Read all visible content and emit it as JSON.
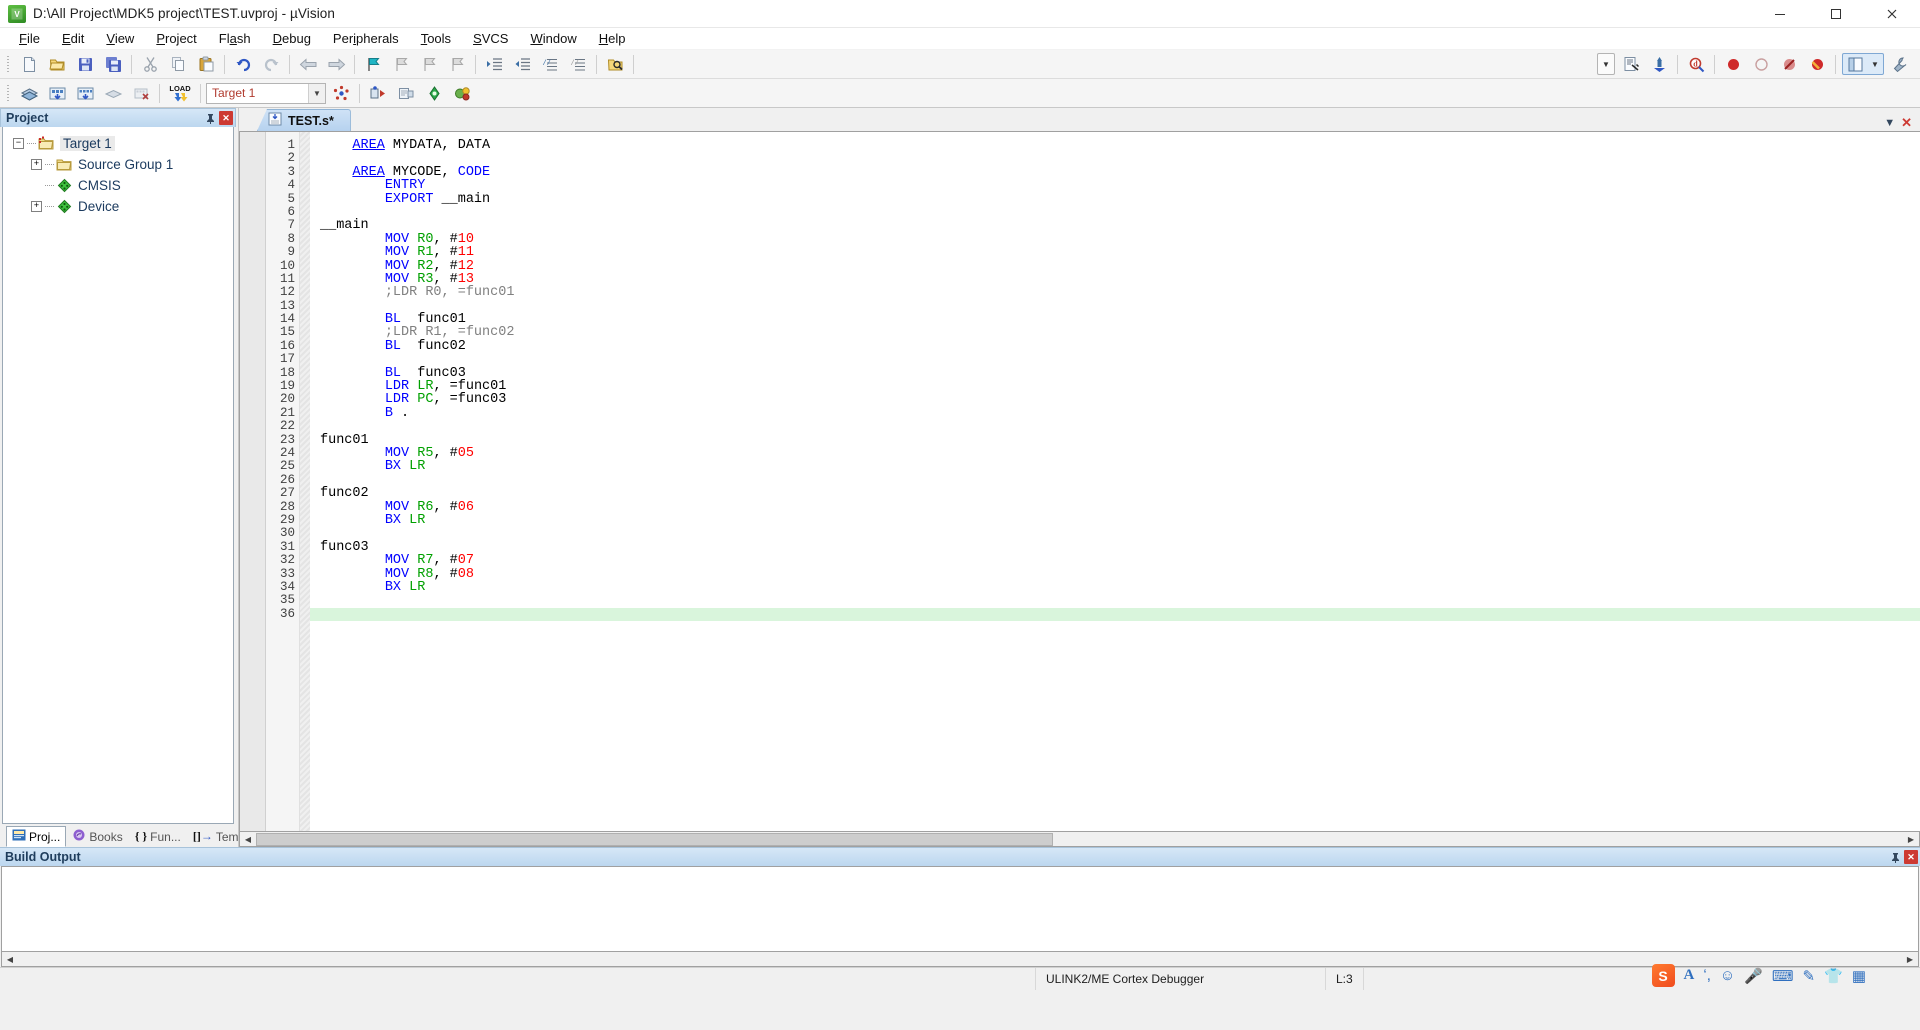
{
  "window": {
    "title": "D:\\All Project\\MDK5 project\\TEST.uvproj - µVision",
    "app_icon": "uvision-logo-icon",
    "minimize": "─",
    "maximize": "□",
    "close": "✕"
  },
  "menu": {
    "items": [
      {
        "label": "File",
        "accel": "F"
      },
      {
        "label": "Edit",
        "accel": "E"
      },
      {
        "label": "View",
        "accel": "V"
      },
      {
        "label": "Project",
        "accel": "P"
      },
      {
        "label": "Flash",
        "accel": "a"
      },
      {
        "label": "Debug",
        "accel": "D"
      },
      {
        "label": "Peripherals",
        "accel": "i"
      },
      {
        "label": "Tools",
        "accel": "T"
      },
      {
        "label": "SVCS",
        "accel": "S"
      },
      {
        "label": "Window",
        "accel": "W"
      },
      {
        "label": "Help",
        "accel": "H"
      }
    ]
  },
  "toolbar_main": {
    "buttons": [
      {
        "name": "new-file-icon",
        "title": "New"
      },
      {
        "name": "open-file-icon",
        "title": "Open"
      },
      {
        "name": "save-icon",
        "title": "Save"
      },
      {
        "name": "save-all-icon",
        "title": "Save All"
      },
      {
        "name": "cut-icon",
        "title": "Cut"
      },
      {
        "name": "copy-icon",
        "title": "Copy"
      },
      {
        "name": "paste-icon",
        "title": "Paste"
      },
      {
        "name": "undo-icon",
        "title": "Undo"
      },
      {
        "name": "redo-icon",
        "title": "Redo"
      },
      {
        "name": "back-icon",
        "title": "Navigate Backwards"
      },
      {
        "name": "forward-icon",
        "title": "Navigate Forwards"
      },
      {
        "name": "bookmark-toggle-icon",
        "title": "Insert/Remove Bookmark"
      },
      {
        "name": "bookmark-prev-icon",
        "title": "Previous Bookmark"
      },
      {
        "name": "bookmark-next-icon",
        "title": "Next Bookmark"
      },
      {
        "name": "bookmark-clear-icon",
        "title": "Clear All Bookmarks"
      },
      {
        "name": "indent-icon",
        "title": "Indent"
      },
      {
        "name": "outdent-icon",
        "title": "Outdent"
      },
      {
        "name": "comment-icon",
        "title": "Comment"
      },
      {
        "name": "uncomment-icon",
        "title": "Uncomment"
      },
      {
        "name": "find-in-files-icon",
        "title": "Find in Files"
      },
      {
        "name": "configure-icon",
        "title": "Configuration Wizard"
      },
      {
        "name": "bookmark-flag-icon",
        "title": "Bookmarks"
      },
      {
        "name": "find-icon",
        "title": "Find"
      },
      {
        "name": "breakpoint-icon",
        "title": "Insert/Remove Breakpoint"
      },
      {
        "name": "breakpoint-disable-icon",
        "title": "Enable/Disable Breakpoint"
      },
      {
        "name": "breakpoint-disable-all-icon",
        "title": "Disable All Breakpoints"
      },
      {
        "name": "breakpoint-kill-all-icon",
        "title": "Kill All Breakpoints"
      },
      {
        "name": "window-layout-icon",
        "title": "Manage Window Layout"
      },
      {
        "name": "wrench-icon",
        "title": "Configure"
      }
    ]
  },
  "toolbar_build": {
    "buttons": [
      {
        "name": "translate-icon",
        "title": "Translate"
      },
      {
        "name": "build-icon",
        "title": "Build"
      },
      {
        "name": "rebuild-icon",
        "title": "Rebuild"
      },
      {
        "name": "batch-build-icon",
        "title": "Batch Build"
      },
      {
        "name": "stop-build-icon",
        "title": "Stop Build"
      },
      {
        "name": "download-icon",
        "title": "Download"
      },
      {
        "name": "target-options-icon",
        "title": "Target Options"
      },
      {
        "name": "manage-components-icon",
        "title": "Manage Components"
      },
      {
        "name": "pack-installer-icon",
        "title": "Pack Installer"
      },
      {
        "name": "run-to-main-icon",
        "title": "Start Debug"
      }
    ],
    "load_label": "LOAD",
    "target_value": "Target 1",
    "target_placeholder": "Target 1"
  },
  "project_panel": {
    "title": "Project",
    "pin": "⇲",
    "close": "✕",
    "tree": [
      {
        "label": "Target 1",
        "icon": "project-target-icon",
        "expander": "−",
        "level": 0,
        "selected": true
      },
      {
        "label": "Source Group 1",
        "icon": "folder-icon",
        "expander": "+",
        "level": 1,
        "selected": false
      },
      {
        "label": "CMSIS",
        "icon": "green-diamond-icon",
        "expander": "",
        "level": 1,
        "selected": false
      },
      {
        "label": "Device",
        "icon": "green-diamond-icon",
        "expander": "+",
        "level": 1,
        "selected": false
      }
    ],
    "tabs": [
      {
        "label": "Proj...",
        "icon": "project-tab-icon",
        "active": true
      },
      {
        "label": "Books",
        "icon": "books-icon",
        "active": false
      },
      {
        "label": "Fun...",
        "icon": "functions-icon",
        "active": false
      },
      {
        "label": "Tem...",
        "icon": "templates-icon",
        "active": false
      }
    ]
  },
  "editor": {
    "tab": {
      "label": "TEST.s*",
      "icon": "assembly-file-icon"
    },
    "tab_controls": {
      "down": "▼",
      "close": "✕"
    },
    "highlight_line": 36,
    "lines": [
      {
        "n": 1,
        "tokens": [
          {
            "t": "AREA",
            "c": "kw-u"
          },
          {
            "t": " MYDATA, DATA",
            "c": "pln"
          }
        ],
        "indent": 1
      },
      {
        "n": 2,
        "tokens": [],
        "indent": 0
      },
      {
        "n": 3,
        "tokens": [
          {
            "t": "AREA",
            "c": "kw-u"
          },
          {
            "t": " MYCODE, ",
            "c": "pln"
          },
          {
            "t": "CODE",
            "c": "kw"
          }
        ],
        "indent": 1
      },
      {
        "n": 4,
        "tokens": [
          {
            "t": "ENTRY",
            "c": "kw"
          }
        ],
        "indent": 2
      },
      {
        "n": 5,
        "tokens": [
          {
            "t": "EXPORT",
            "c": "kw"
          },
          {
            "t": " __main",
            "c": "pln"
          }
        ],
        "indent": 2
      },
      {
        "n": 6,
        "tokens": [],
        "indent": 0
      },
      {
        "n": 7,
        "tokens": [
          {
            "t": "__main",
            "c": "pln"
          }
        ],
        "indent": 0
      },
      {
        "n": 8,
        "tokens": [
          {
            "t": "MOV",
            "c": "kw"
          },
          {
            "t": " ",
            "c": "pln"
          },
          {
            "t": "R0",
            "c": "reg"
          },
          {
            "t": ", #",
            "c": "pln"
          },
          {
            "t": "10",
            "c": "num"
          }
        ],
        "indent": 2
      },
      {
        "n": 9,
        "tokens": [
          {
            "t": "MOV",
            "c": "kw"
          },
          {
            "t": " ",
            "c": "pln"
          },
          {
            "t": "R1",
            "c": "reg"
          },
          {
            "t": ", #",
            "c": "pln"
          },
          {
            "t": "11",
            "c": "num"
          }
        ],
        "indent": 2
      },
      {
        "n": 10,
        "tokens": [
          {
            "t": "MOV",
            "c": "kw"
          },
          {
            "t": " ",
            "c": "pln"
          },
          {
            "t": "R2",
            "c": "reg"
          },
          {
            "t": ", #",
            "c": "pln"
          },
          {
            "t": "12",
            "c": "num"
          }
        ],
        "indent": 2
      },
      {
        "n": 11,
        "tokens": [
          {
            "t": "MOV",
            "c": "kw"
          },
          {
            "t": " ",
            "c": "pln"
          },
          {
            "t": "R3",
            "c": "reg"
          },
          {
            "t": ", #",
            "c": "pln"
          },
          {
            "t": "13",
            "c": "num"
          }
        ],
        "indent": 2
      },
      {
        "n": 12,
        "tokens": [
          {
            "t": ";LDR R0, =func01",
            "c": "cmt"
          }
        ],
        "indent": 2
      },
      {
        "n": 13,
        "tokens": [],
        "indent": 0
      },
      {
        "n": 14,
        "tokens": [
          {
            "t": "BL",
            "c": "kw"
          },
          {
            "t": "  func01",
            "c": "pln"
          }
        ],
        "indent": 2
      },
      {
        "n": 15,
        "tokens": [
          {
            "t": ";LDR R1, =func02",
            "c": "cmt"
          }
        ],
        "indent": 2
      },
      {
        "n": 16,
        "tokens": [
          {
            "t": "BL",
            "c": "kw"
          },
          {
            "t": "  func02",
            "c": "pln"
          }
        ],
        "indent": 2
      },
      {
        "n": 17,
        "tokens": [],
        "indent": 0
      },
      {
        "n": 18,
        "tokens": [
          {
            "t": "BL",
            "c": "kw"
          },
          {
            "t": "  func03",
            "c": "pln"
          }
        ],
        "indent": 2
      },
      {
        "n": 19,
        "tokens": [
          {
            "t": "LDR",
            "c": "kw"
          },
          {
            "t": " ",
            "c": "pln"
          },
          {
            "t": "LR",
            "c": "reg"
          },
          {
            "t": ", =func01",
            "c": "pln"
          }
        ],
        "indent": 2
      },
      {
        "n": 20,
        "tokens": [
          {
            "t": "LDR",
            "c": "kw"
          },
          {
            "t": " ",
            "c": "pln"
          },
          {
            "t": "PC",
            "c": "reg"
          },
          {
            "t": ", =func03",
            "c": "pln"
          }
        ],
        "indent": 2
      },
      {
        "n": 21,
        "tokens": [
          {
            "t": "B",
            "c": "kw"
          },
          {
            "t": " .",
            "c": "pln"
          }
        ],
        "indent": 2
      },
      {
        "n": 22,
        "tokens": [],
        "indent": 0
      },
      {
        "n": 23,
        "tokens": [
          {
            "t": "func01",
            "c": "pln"
          }
        ],
        "indent": 0
      },
      {
        "n": 24,
        "tokens": [
          {
            "t": "MOV",
            "c": "kw"
          },
          {
            "t": " ",
            "c": "pln"
          },
          {
            "t": "R5",
            "c": "reg"
          },
          {
            "t": ", #",
            "c": "pln"
          },
          {
            "t": "05",
            "c": "num"
          }
        ],
        "indent": 2
      },
      {
        "n": 25,
        "tokens": [
          {
            "t": "BX",
            "c": "kw"
          },
          {
            "t": " ",
            "c": "pln"
          },
          {
            "t": "LR",
            "c": "reg"
          }
        ],
        "indent": 2
      },
      {
        "n": 26,
        "tokens": [],
        "indent": 0
      },
      {
        "n": 27,
        "tokens": [
          {
            "t": "func02",
            "c": "pln"
          }
        ],
        "indent": 0
      },
      {
        "n": 28,
        "tokens": [
          {
            "t": "MOV",
            "c": "kw"
          },
          {
            "t": " ",
            "c": "pln"
          },
          {
            "t": "R6",
            "c": "reg"
          },
          {
            "t": ", #",
            "c": "pln"
          },
          {
            "t": "06",
            "c": "num"
          }
        ],
        "indent": 2
      },
      {
        "n": 29,
        "tokens": [
          {
            "t": "BX",
            "c": "kw"
          },
          {
            "t": " ",
            "c": "pln"
          },
          {
            "t": "LR",
            "c": "reg"
          }
        ],
        "indent": 2
      },
      {
        "n": 30,
        "tokens": [],
        "indent": 0
      },
      {
        "n": 31,
        "tokens": [
          {
            "t": "func03",
            "c": "pln"
          }
        ],
        "indent": 0
      },
      {
        "n": 32,
        "tokens": [
          {
            "t": "MOV",
            "c": "kw"
          },
          {
            "t": " ",
            "c": "pln"
          },
          {
            "t": "R7",
            "c": "reg"
          },
          {
            "t": ", #",
            "c": "pln"
          },
          {
            "t": "07",
            "c": "num"
          }
        ],
        "indent": 2
      },
      {
        "n": 33,
        "tokens": [
          {
            "t": "MOV",
            "c": "kw"
          },
          {
            "t": " ",
            "c": "pln"
          },
          {
            "t": "R8",
            "c": "reg"
          },
          {
            "t": ", #",
            "c": "pln"
          },
          {
            "t": "08",
            "c": "num"
          }
        ],
        "indent": 2
      },
      {
        "n": 34,
        "tokens": [
          {
            "t": "BX",
            "c": "kw"
          },
          {
            "t": " ",
            "c": "pln"
          },
          {
            "t": "LR",
            "c": "reg"
          }
        ],
        "indent": 2
      },
      {
        "n": 35,
        "tokens": [],
        "indent": 0
      },
      {
        "n": 36,
        "tokens": [],
        "indent": 0
      }
    ]
  },
  "build_output": {
    "title": "Build Output",
    "pin": "⇲",
    "close": "✕",
    "content": ""
  },
  "statusbar": {
    "debugger": "ULINK2/ME Cortex Debugger",
    "line_col": "L:3",
    "ime": {
      "logo": "S",
      "icons": [
        "font-icon",
        "punctuation-icon",
        "emoji-icon",
        "voice-icon",
        "keyboard-icon",
        "handwriting-icon",
        "skin-icon",
        "toolbox-icon"
      ]
    }
  },
  "colors": {
    "keyword": "#0000ff",
    "register": "#00a000",
    "number": "#ff0000",
    "comment": "#808080",
    "highlight_line": "#d9f5dc",
    "caption_gradient_top": "#d6e7f7",
    "caption_gradient_bottom": "#bcd7ef"
  }
}
